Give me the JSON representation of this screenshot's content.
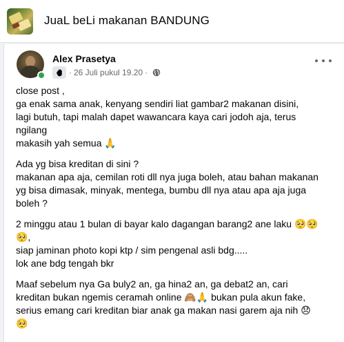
{
  "group": {
    "title": "JuaL beLi makanan BANDUNG"
  },
  "post": {
    "author": "Alex Prasetya",
    "timestamp": "26 Juli pukul 19.20",
    "dot": "·",
    "paragraphs": [
      [
        "close post ,",
        "ga enak sama anak, kenyang sendiri liat gambar2 makanan disini,",
        "lagi butuh, tapi malah dapet wawancara kaya cari jodoh aja, terus",
        "ngilang",
        "makasih yah semua 🙏"
      ],
      [
        "Ada yg bisa kreditan di sini ?",
        "makanan apa aja, cemilan roti dll nya juga boleh, atau bahan makanan",
        "yg bisa dimasak, minyak, mentega, bumbu dll nya atau apa aja juga",
        "boleh ?"
      ],
      [
        "2 minggu atau 1 bulan di bayar kalo dagangan barang2 ane laku 🥺🥺",
        "🥺,",
        "siap jaminan photo kopi ktp / sim pengenal asli bdg.....",
        "lok ane bdg tengah bkr"
      ],
      [
        "Maaf sebelum nya Ga buly2 an, ga hina2 an, ga debat2 an, cari",
        "kreditan bukan ngemis ceramah online 🙈🙏 bukan pula akun fake,",
        "serius emang cari kreditan biar anak ga makan nasi garem aja nih 😞",
        "🥺"
      ]
    ]
  },
  "icons": {
    "badge": "waving-hand-icon",
    "privacy": "globe-icon",
    "more": "more-options-icon"
  },
  "colors": {
    "online": "#31a24c",
    "meta_text": "#65676b",
    "background": "#f0f2f5"
  }
}
